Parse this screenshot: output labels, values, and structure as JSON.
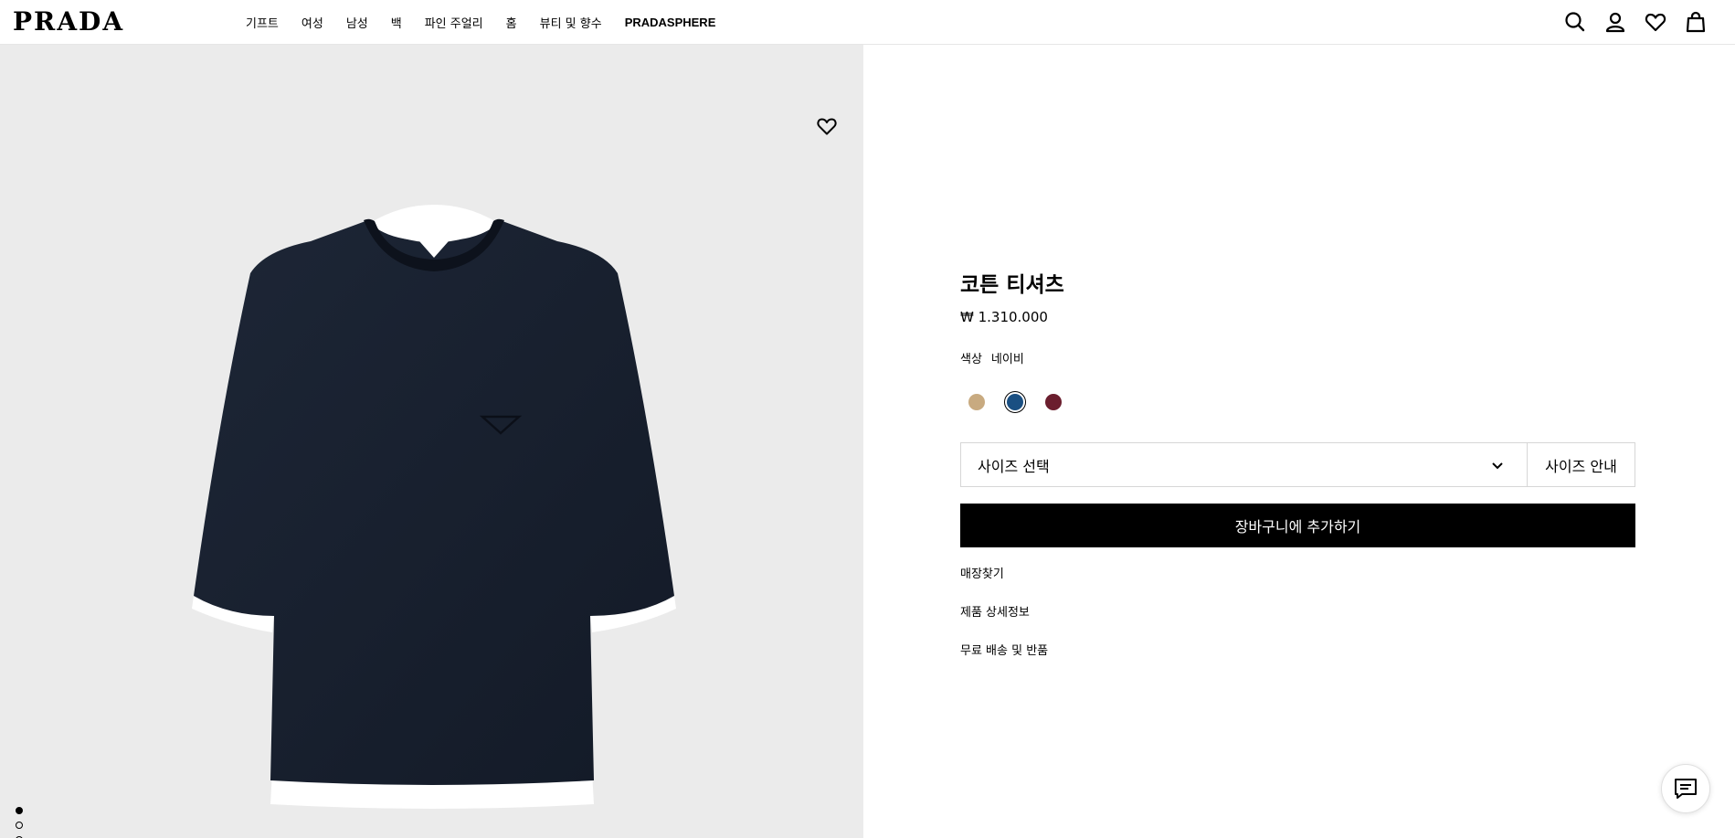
{
  "brand": {
    "logo_text": "PRADA"
  },
  "nav": {
    "items": [
      {
        "label": "기프트"
      },
      {
        "label": "여성"
      },
      {
        "label": "남성"
      },
      {
        "label": "백"
      },
      {
        "label": "파인 주얼리"
      },
      {
        "label": "홈"
      },
      {
        "label": "뷰티 및 향수"
      },
      {
        "label": "PRADASPHERE"
      }
    ]
  },
  "header_icons": [
    "search-icon",
    "account-icon",
    "wishlist-heart-icon",
    "shopping-bag-icon"
  ],
  "gallery": {
    "image_count": 5,
    "active_index": 0,
    "wishlist_icon": "heart-outline-icon"
  },
  "product": {
    "title": "코튼 티셔츠",
    "price": "₩ 1.310.000",
    "color_label": "색상",
    "color_value": "네이비",
    "swatches": [
      {
        "color": "#c8aa80",
        "selected": false
      },
      {
        "color": "#1a4f82",
        "selected": true
      },
      {
        "color": "#6b1e2e",
        "selected": false
      }
    ],
    "size_select_label": "사이즈 선택",
    "size_guide_label": "사이즈 안내",
    "add_to_cart_label": "장바구니에 추가하기",
    "links": [
      {
        "label": "매장찾기"
      },
      {
        "label": "제품 상세정보"
      },
      {
        "label": "무료 배송 및 반품"
      }
    ]
  },
  "chat": {
    "icon": "chat-bubble-icon"
  }
}
